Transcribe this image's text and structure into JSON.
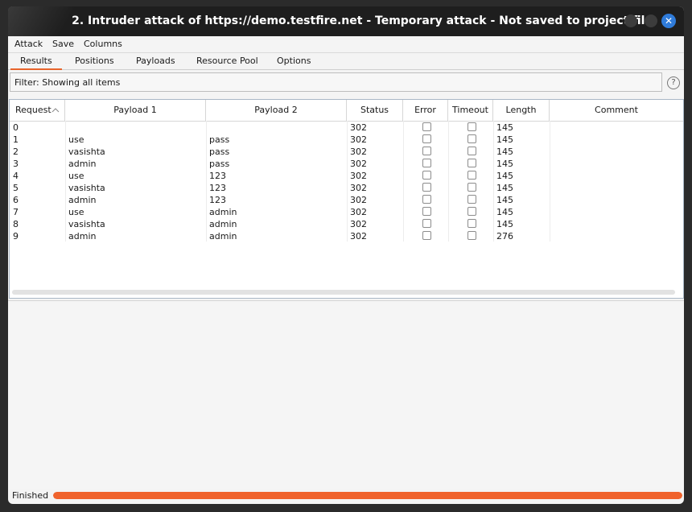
{
  "window": {
    "title": "2. Intruder attack of https://demo.testfire.net - Temporary attack - Not saved to project file",
    "close_glyph": "✕"
  },
  "menu": [
    "Attack",
    "Save",
    "Columns"
  ],
  "tabs": [
    "Results",
    "Positions",
    "Payloads",
    "Resource Pool",
    "Options"
  ],
  "active_tab": "Results",
  "filter": {
    "text": "Filter: Showing all items"
  },
  "help_glyph": "?",
  "table": {
    "columns": [
      "Request",
      "Payload 1",
      "Payload 2",
      "Status",
      "Error",
      "Timeout",
      "Length",
      "Comment"
    ],
    "sort_column": "Request",
    "sort_icon": "sort-ascending-icon",
    "rows": [
      {
        "request": "0",
        "payload1": "",
        "payload2": "",
        "status": "302",
        "error": false,
        "timeout": false,
        "length": "145",
        "comment": ""
      },
      {
        "request": "1",
        "payload1": "use",
        "payload2": "pass",
        "status": "302",
        "error": false,
        "timeout": false,
        "length": "145",
        "comment": ""
      },
      {
        "request": "2",
        "payload1": "vasishta",
        "payload2": "pass",
        "status": "302",
        "error": false,
        "timeout": false,
        "length": "145",
        "comment": ""
      },
      {
        "request": "3",
        "payload1": "admin",
        "payload2": "pass",
        "status": "302",
        "error": false,
        "timeout": false,
        "length": "145",
        "comment": ""
      },
      {
        "request": "4",
        "payload1": "use",
        "payload2": "123",
        "status": "302",
        "error": false,
        "timeout": false,
        "length": "145",
        "comment": ""
      },
      {
        "request": "5",
        "payload1": "vasishta",
        "payload2": "123",
        "status": "302",
        "error": false,
        "timeout": false,
        "length": "145",
        "comment": ""
      },
      {
        "request": "6",
        "payload1": "admin",
        "payload2": "123",
        "status": "302",
        "error": false,
        "timeout": false,
        "length": "145",
        "comment": ""
      },
      {
        "request": "7",
        "payload1": "use",
        "payload2": "admin",
        "status": "302",
        "error": false,
        "timeout": false,
        "length": "145",
        "comment": ""
      },
      {
        "request": "8",
        "payload1": "vasishta",
        "payload2": "admin",
        "status": "302",
        "error": false,
        "timeout": false,
        "length": "145",
        "comment": ""
      },
      {
        "request": "9",
        "payload1": "admin",
        "payload2": "admin",
        "status": "302",
        "error": false,
        "timeout": false,
        "length": "276",
        "comment": ""
      }
    ]
  },
  "status": {
    "text": "Finished",
    "progress": 1.0
  },
  "colors": {
    "accent": "#f0632d",
    "title_bg": "#1e1e1e",
    "close_btn": "#2f7bd9"
  }
}
